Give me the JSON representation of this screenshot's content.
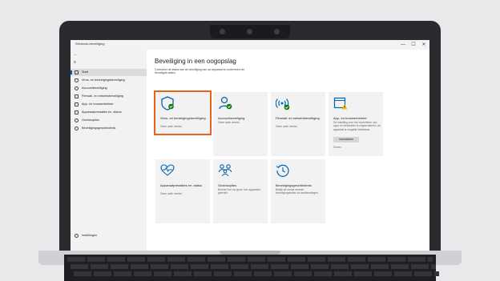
{
  "window": {
    "title": "Windows-beveiliging",
    "minimize": "—",
    "maximize": "☐",
    "close": "✕"
  },
  "sidebar": {
    "back": "←",
    "menu": "≡",
    "items": [
      {
        "label": "Start",
        "active": true
      },
      {
        "label": "Virus- en bedreigingsbeveiliging"
      },
      {
        "label": "Accountbeveiliging"
      },
      {
        "label": "Firewall- en netwerkbeveiliging"
      },
      {
        "label": "App- en browserbeheer"
      },
      {
        "label": "Apparaatprestaties en -status"
      },
      {
        "label": "Gezinsopties"
      },
      {
        "label": "Beveiligingsgeschiedenis"
      }
    ],
    "settings": "Instellingen"
  },
  "main": {
    "title": "Beveiliging in een oogopslag",
    "intro": "Controleer de status van de beveiliging van uw apparaat en onderneem de benodigde acties.",
    "tiles": [
      {
        "name": "Virus- en bedreigingsbeveiliging",
        "status": "Geen actie vereist.",
        "icon": "shield-icon",
        "state": "ok"
      },
      {
        "name": "Accountbeveiliging",
        "status": "Geen actie vereist.",
        "icon": "person-icon",
        "state": "ok"
      },
      {
        "name": "Firewall- en netwerkbeveiliging",
        "status": "Geen actie vereist.",
        "icon": "wifi-antenna-icon",
        "state": "ok"
      },
      {
        "name": "App- en browserbeheer",
        "status": "De instelling voor het controleren van apps en bestanden is uitgeschakeld. Uw apparaat is mogelijk kwetsbaar.",
        "icon": "app-browser-icon",
        "state": "warning",
        "button": "Inschakelen",
        "dismiss": "Sluiten"
      },
      {
        "name": "Apparaatprestaties en -status",
        "status": "Geen actie vereist.",
        "icon": "heart-pulse-icon",
        "state": "none"
      },
      {
        "name": "Gezinsopties",
        "status": "Beheer hoe uw gezin hun apparaten gebruikt.",
        "icon": "family-icon",
        "state": "none"
      },
      {
        "name": "Beveiligingsgeschiedenis",
        "status": "Bekijk de meest recente beveiligingsacties en aanbevelingen.",
        "icon": "history-icon",
        "state": "none"
      }
    ]
  },
  "colors": {
    "accent": "#0063b1",
    "ok": "#107c10",
    "warning": "#ffb900",
    "highlight": "#e8641b"
  }
}
